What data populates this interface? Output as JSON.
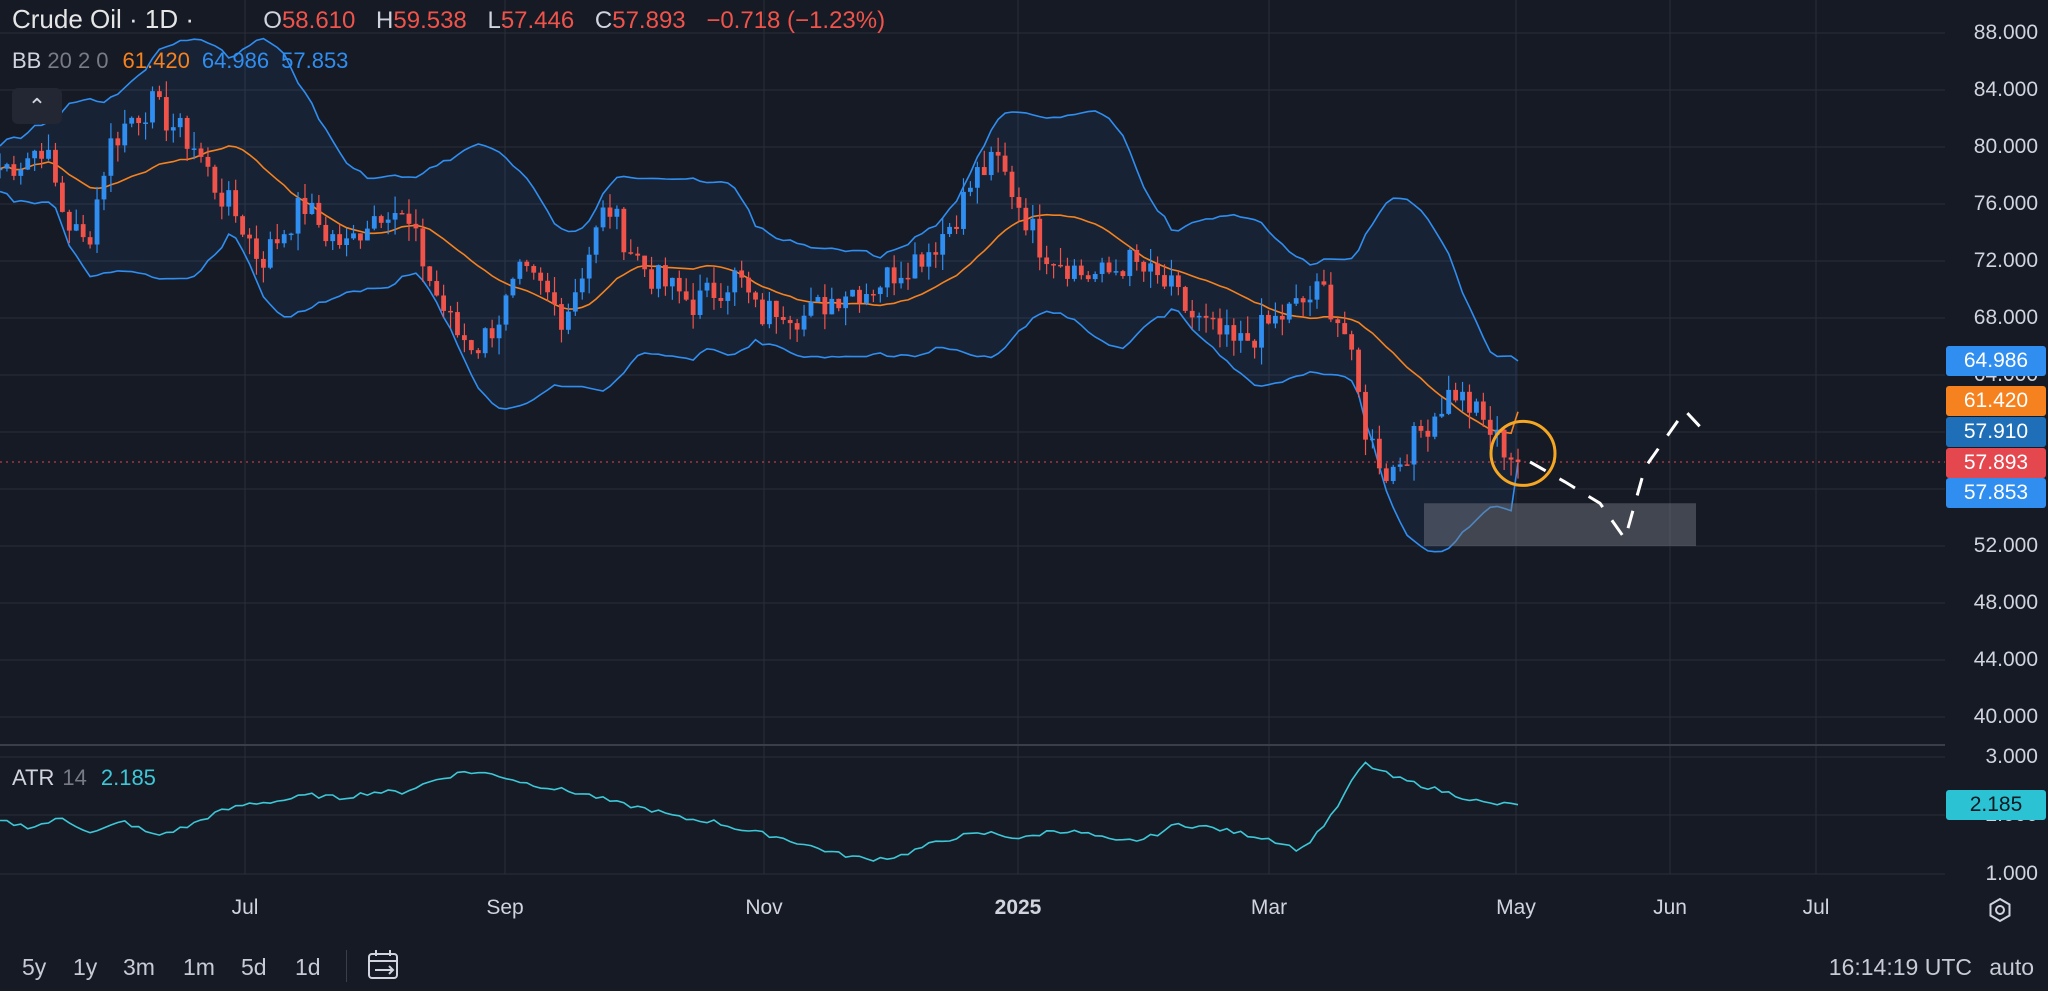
{
  "header": {
    "symbol": "Crude Oil · 1D ·",
    "ohlc": {
      "o_label": "O",
      "o": "58.610",
      "h_label": "H",
      "h": "59.538",
      "l_label": "L",
      "l": "57.446",
      "c_label": "C",
      "c": "57.893",
      "change": "−0.718 (−1.23%)"
    }
  },
  "bb": {
    "name": "BB",
    "params": "20 2 0",
    "upper_mid": "61.420",
    "upper": "64.986",
    "lower": "57.853"
  },
  "atr": {
    "name": "ATR",
    "params": "14",
    "value": "2.185"
  },
  "price_axis": [
    "88.000",
    "84.000",
    "80.000",
    "76.000",
    "72.000",
    "68.000",
    "64.000",
    "52.000",
    "48.000",
    "44.000",
    "40.000"
  ],
  "atr_axis": [
    "3.000",
    "2.000",
    "1.000"
  ],
  "tags": {
    "upper": "64.986",
    "basis": "61.420",
    "last_bar": "57.910",
    "close": "57.893",
    "lower": "57.853",
    "atr": "2.185"
  },
  "colors": {
    "bg": "#161a25",
    "up": "#2f8ef0",
    "down": "#f0534a",
    "basis": "#f5821f",
    "band": "#2f8ef0",
    "atr": "#3dc8d8",
    "grid": "#2a2e39"
  },
  "time_axis": [
    "Jul",
    "Sep",
    "Nov",
    "2025",
    "Mar",
    "May",
    "Jun",
    "Jul"
  ],
  "timeframes": [
    "5y",
    "1y",
    "3m",
    "1m",
    "5d",
    "1d"
  ],
  "time_display": "16:14:19 UTC",
  "scale_mode": "auto",
  "icons": {
    "collapse": "chevron-up-icon",
    "calendar": "calendar-range-icon",
    "settings": "gear-icon"
  },
  "chart_data": {
    "type": "candlestick",
    "title": "Crude Oil · 1D",
    "ylim": [
      38,
      90
    ],
    "x_labels": [
      "Jul",
      "Sep",
      "Nov",
      "2025",
      "Mar",
      "May",
      "Jun",
      "Jul"
    ],
    "close_approx": [
      78.5,
      79,
      80.2,
      75,
      73,
      80,
      82,
      83,
      81.5,
      80,
      77,
      75,
      72,
      74,
      76,
      74,
      73,
      75,
      76,
      74,
      70,
      67,
      66,
      68,
      71,
      70,
      68,
      72,
      76,
      73,
      71,
      70,
      69,
      70,
      71,
      68,
      69,
      68,
      69,
      70,
      70,
      71,
      72,
      73,
      75,
      78,
      79,
      76,
      73,
      72,
      71,
      71,
      72,
      71,
      70,
      68,
      67,
      66,
      67,
      68,
      69,
      70,
      67,
      60,
      57,
      59,
      61,
      63,
      61.4,
      59.5,
      57.893
    ],
    "bollinger": {
      "period": 20,
      "stddev": 2,
      "upper": 64.986,
      "basis": 61.42,
      "lower": 57.853
    },
    "atr": {
      "period": 14,
      "last": 2.185,
      "ylim": [
        1,
        3
      ]
    },
    "last_price": 57.893,
    "annotations": {
      "support_zone": [
        52,
        55
      ],
      "highlight_circle_price": 58.5,
      "projected_path": [
        57.9,
        56.5,
        55,
        52.5,
        57.5,
        61.5,
        60
      ]
    }
  }
}
